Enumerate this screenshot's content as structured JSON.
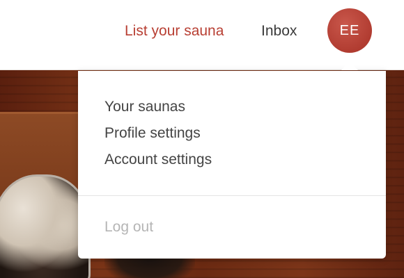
{
  "header": {
    "list_link": "List your sauna",
    "inbox_link": "Inbox",
    "avatar_initials": "EE"
  },
  "dropdown": {
    "items": [
      {
        "label": "Your saunas"
      },
      {
        "label": "Profile settings"
      },
      {
        "label": "Account settings"
      }
    ],
    "logout_label": "Log out"
  },
  "colors": {
    "accent": "#b83f33",
    "avatar_bg": "#b13c31",
    "text": "#444444",
    "disabled_text": "#b5b5b5"
  }
}
